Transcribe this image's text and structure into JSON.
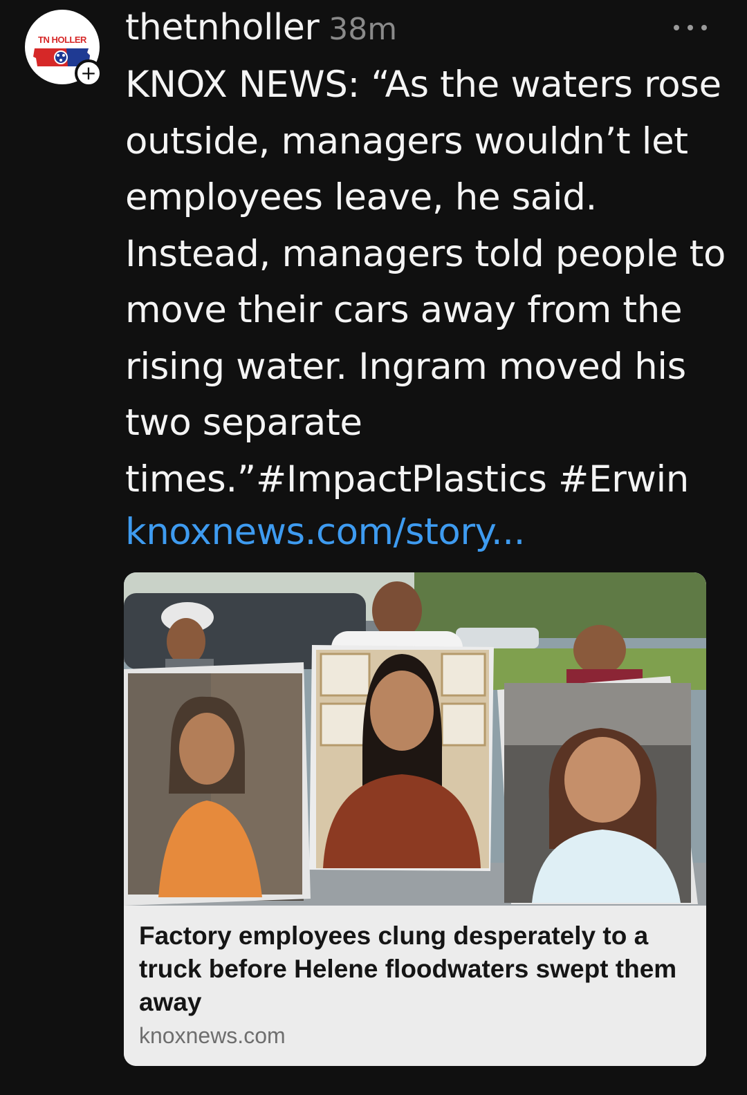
{
  "post": {
    "avatar_logo_text": "TN HOLLER",
    "follow_symbol": "+",
    "username": "thetnholler",
    "timestamp": "38m",
    "body_lines": [
      "KNOX NEWS: “As the waters rose",
      "outside, managers wouldn’t let",
      "employees leave, he said.",
      "Instead, managers told people to",
      "move their cars away from the",
      "rising water. Ingram moved his",
      "two separate",
      "times.”#ImpactPlastics #Erwin"
    ],
    "link_text": "knoxnews.com/story...",
    "more_icon": "more-horizontal-icon"
  },
  "link_card": {
    "title": "Factory employees clung desperately to a truck before Helene floodwaters swept them away",
    "domain": "knoxnews.com"
  },
  "colors": {
    "background": "#101010",
    "text": "#f4f4f4",
    "muted": "#8a8a8a",
    "link": "#3e9bf0",
    "card_caption_bg": "#ececec",
    "brand_red": "#d62828",
    "brand_blue": "#1f3a93"
  }
}
